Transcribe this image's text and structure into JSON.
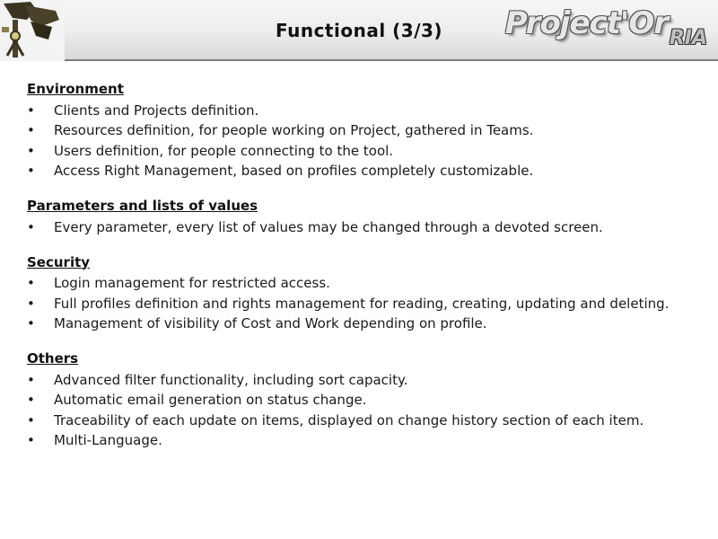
{
  "header": {
    "title": "Functional (3/3)",
    "brand_main": "Project'Or",
    "brand_sub": "RIA",
    "left_logo_icon": "surveyor-theodolite-icon"
  },
  "bullet_glyph": "•",
  "sections": [
    {
      "title": "Environment",
      "items": [
        "Clients and Projects definition.",
        "Resources definition, for people working on Project, gathered in Teams.",
        "Users definition, for people connecting to the tool.",
        "Access Right Management, based on profiles completely customizable."
      ]
    },
    {
      "title": "Parameters and lists of values",
      "items": [
        "Every parameter, every list of values may be changed through a devoted screen."
      ]
    },
    {
      "title": "Security",
      "items": [
        "Login management for restricted access.",
        "Full profiles definition and rights management for reading, creating, updating and deleting.",
        "Management of visibility of Cost and Work depending on profile."
      ]
    },
    {
      "title": "Others",
      "items": [
        "Advanced filter functionality, including sort capacity.",
        "Automatic email generation on status change.",
        "Traceability of each update on items, displayed on change history section of each item.",
        "Multi-Language."
      ]
    }
  ]
}
